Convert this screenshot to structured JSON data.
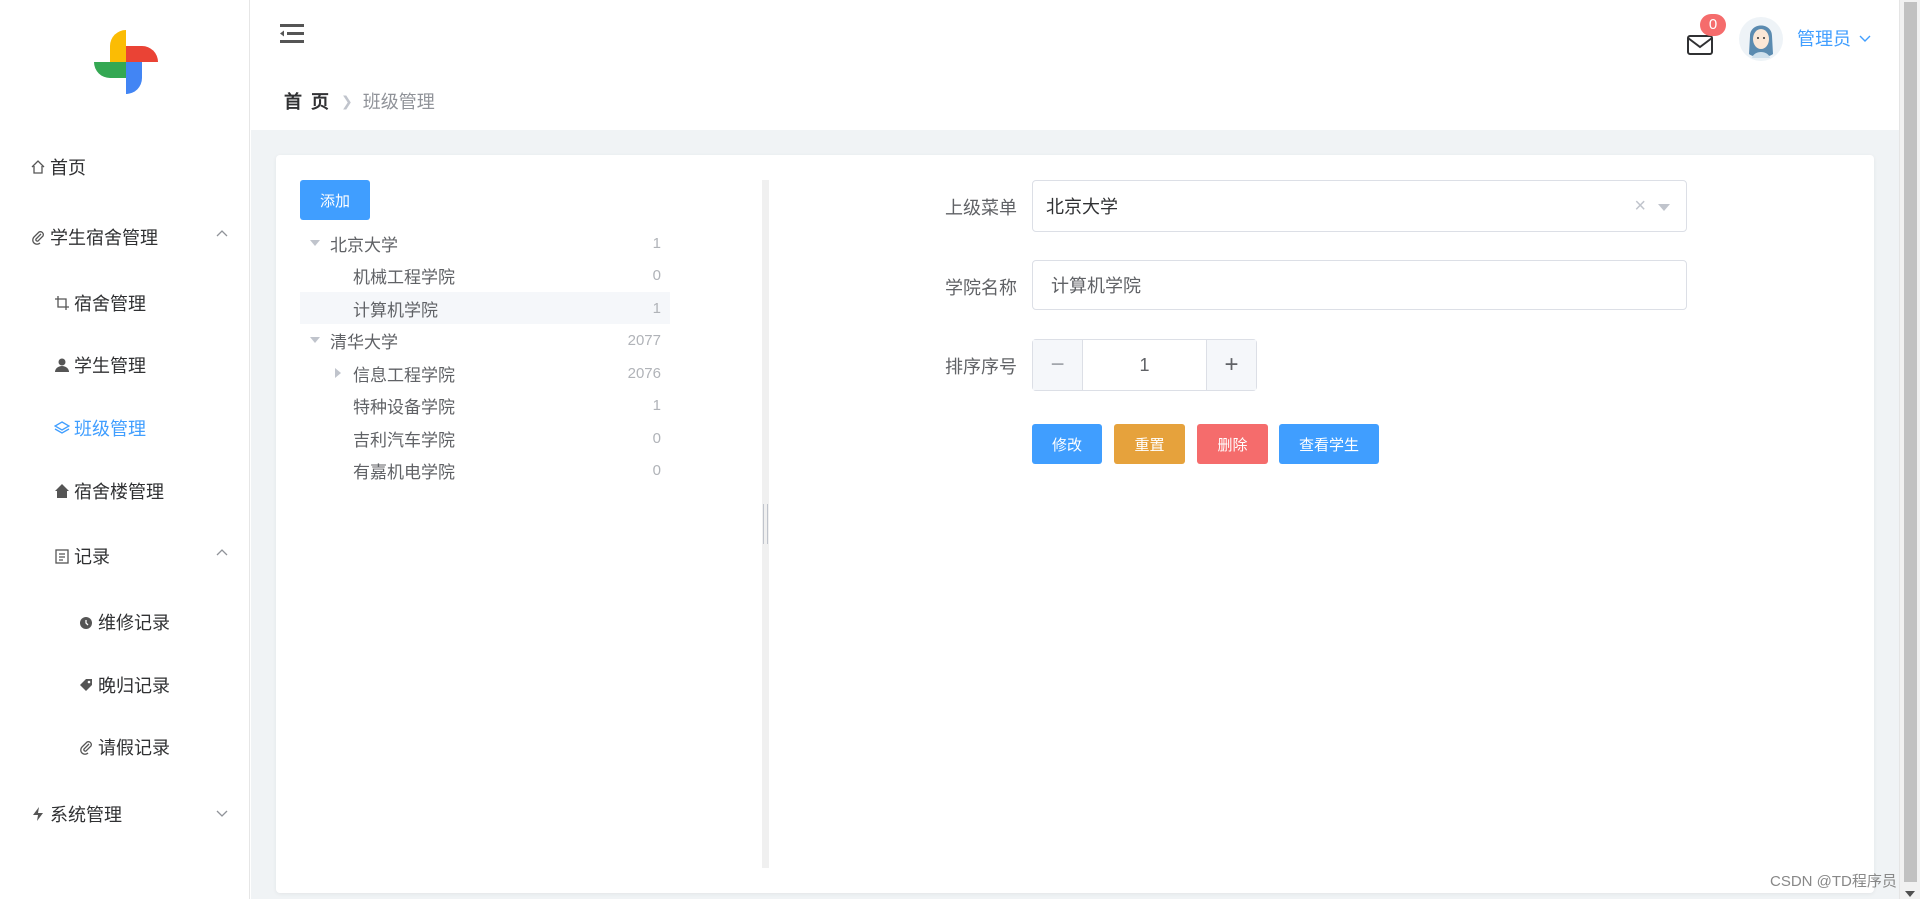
{
  "sidebar": {
    "items": [
      {
        "label": "首页",
        "icon": "home-icon"
      },
      {
        "label": "学生宿舍管理",
        "icon": "paperclip-icon"
      },
      {
        "label": "宿舍管理",
        "icon": "crop-icon"
      },
      {
        "label": "学生管理",
        "icon": "user-icon"
      },
      {
        "label": "班级管理",
        "icon": "layers-icon",
        "active": true
      },
      {
        "label": "宿舍楼管理",
        "icon": "house-icon"
      },
      {
        "label": "记录",
        "icon": "calendar-icon"
      },
      {
        "label": "维修记录",
        "icon": "alarm-icon"
      },
      {
        "label": "晚归记录",
        "icon": "tag-icon"
      },
      {
        "label": "请假记录",
        "icon": "paperclip-icon"
      },
      {
        "label": "系统管理",
        "icon": "lightning-icon"
      }
    ]
  },
  "header": {
    "breadcrumb_home": "首 页",
    "breadcrumb_current": "班级管理",
    "badge_count": "0",
    "user_name": "管理员"
  },
  "tree": {
    "add_label": "添加",
    "nodes": [
      {
        "label": "北京大学",
        "count": "1",
        "level": 0,
        "expand": "down"
      },
      {
        "label": "机械工程学院",
        "count": "0",
        "level": 1,
        "expand": "none"
      },
      {
        "label": "计算机学院",
        "count": "1",
        "level": 1,
        "expand": "none",
        "selected": true
      },
      {
        "label": "清华大学",
        "count": "2077",
        "level": 0,
        "expand": "down"
      },
      {
        "label": "信息工程学院",
        "count": "2076",
        "level": 1,
        "expand": "right"
      },
      {
        "label": "特种设备学院",
        "count": "1",
        "level": 1,
        "expand": "none"
      },
      {
        "label": "吉利汽车学院",
        "count": "0",
        "level": 1,
        "expand": "none"
      },
      {
        "label": "有嘉机电学院",
        "count": "0",
        "level": 1,
        "expand": "none"
      }
    ]
  },
  "form": {
    "parent_label": "上级菜单",
    "parent_value": "北京大学",
    "name_label": "学院名称",
    "name_value": "计算机学院",
    "order_label": "排序序号",
    "order_value": "1",
    "buttons": {
      "edit": "修改",
      "reset": "重置",
      "delete": "删除",
      "view": "查看学生"
    }
  },
  "colors": {
    "primary": "#409eff",
    "warning": "#e6a23c",
    "danger": "#f56c6c"
  },
  "watermark": "CSDN @TD程序员"
}
